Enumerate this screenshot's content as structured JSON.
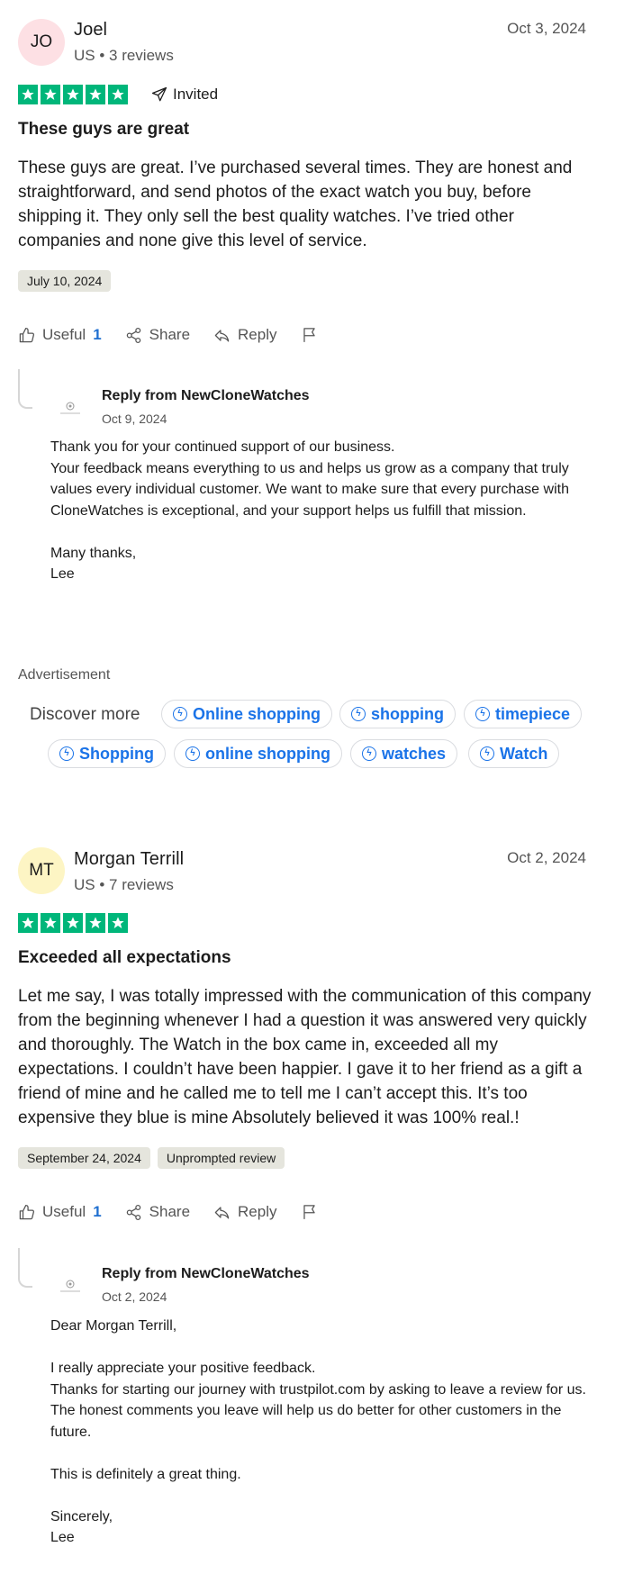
{
  "reviews": [
    {
      "initials": "JO",
      "avatar_color": "#fde0e4",
      "name": "Joel",
      "meta": "US • 3 reviews",
      "date": "Oct 3, 2024",
      "rating": 5,
      "invited_label": "Invited",
      "title": "These guys are great",
      "body": "These guys are great. I’ve purchased several times. They are honest and straightforward, and send photos of the exact watch you buy, before shipping it. They only sell the best quality watches. I’ve tried other companies and none give this level of service.",
      "experience_date": "July 10, 2024",
      "useful_label": "Useful",
      "useful_count": "1",
      "share_label": "Share",
      "reply_label": "Reply",
      "reply": {
        "from": "Reply from NewCloneWatches",
        "date": "Oct 9, 2024",
        "text": "Thank you for your continued support of our business.\nYour feedback means everything to us and helps us grow as a company that truly values every individual customer. We want to make sure that every purchase with CloneWatches is exceptional, and your support helps us fulfill that mission.\n\nMany thanks,\nLee"
      }
    },
    {
      "initials": "MT",
      "avatar_color": "#fdf5c4",
      "name": "Morgan Terrill",
      "meta": "US • 7 reviews",
      "date": "Oct 2, 2024",
      "rating": 5,
      "title": "Exceeded all expectations",
      "body": "Let me say, I was totally impressed with the communication of this company from the beginning whenever I had a question it was answered very quickly and thoroughly. The Watch in the box came in, exceeded all my expectations. I couldn’t have been happier. I gave it to her friend as a gift a friend of mine and he called me to tell me I can’t accept this. It’s too expensive they blue is mine Absolutely believed it was 100% real.!",
      "experience_date": "September 24, 2024",
      "badge": "Unprompted review",
      "useful_label": "Useful",
      "useful_count": "1",
      "share_label": "Share",
      "reply_label": "Reply",
      "reply": {
        "from": "Reply from NewCloneWatches",
        "date": "Oct 2, 2024",
        "text": "Dear Morgan Terrill,\n\nI really appreciate your positive feedback.\nThanks for starting our journey with trustpilot.com by asking to leave a review for us.\nThe honest comments you leave will help us do better for other customers in the future.\n\nThis is definitely a great thing.\n\nSincerely,\nLee"
      }
    }
  ],
  "ad": {
    "label": "Advertisement",
    "discover_label": "Discover more",
    "pills_row1": [
      "Online shopping",
      "shopping",
      "timepiece"
    ],
    "pills_row2": [
      "Shopping",
      "online shopping",
      "watches",
      "Watch"
    ]
  },
  "colors": {
    "star_green": "#00b67a",
    "link_blue": "#1a73e8",
    "useful_blue": "#1f6fd0"
  },
  "icons": [
    "thumbs-up-icon",
    "share-icon",
    "reply-icon",
    "flag-icon",
    "send-icon",
    "star-icon",
    "search-spark-icon"
  ]
}
